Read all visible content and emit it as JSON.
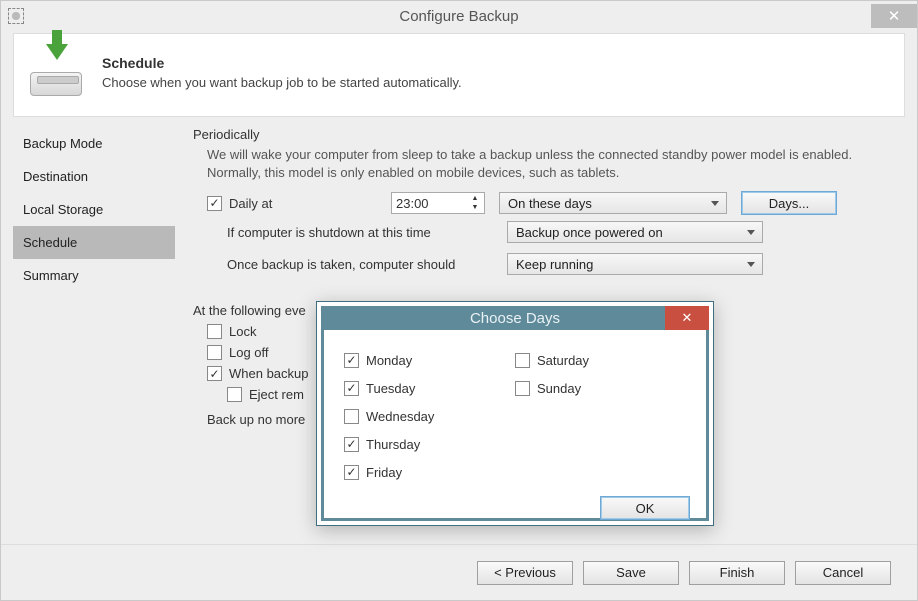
{
  "window": {
    "title": "Configure Backup",
    "close_glyph": "✕"
  },
  "header": {
    "title": "Schedule",
    "subtitle": "Choose when you want backup job to be started automatically."
  },
  "sidebar": {
    "items": [
      {
        "label": "Backup Mode",
        "active": false
      },
      {
        "label": "Destination",
        "active": false
      },
      {
        "label": "Local Storage",
        "active": false
      },
      {
        "label": "Schedule",
        "active": true
      },
      {
        "label": "Summary",
        "active": false
      }
    ]
  },
  "periodically": {
    "title": "Periodically",
    "note": "We will wake your computer from sleep to take a backup unless the connected standby power model is enabled. Normally, this model is only enabled on mobile devices, such as tablets.",
    "daily_checked": true,
    "daily_label": "Daily at",
    "daily_time": "23:00",
    "recurrence_value": "On these days",
    "days_button": "Days...",
    "shutdown_label": "If computer is shutdown at this time",
    "shutdown_value": "Backup once powered on",
    "after_label": "Once backup is taken, computer should",
    "after_value": "Keep running"
  },
  "events": {
    "title_fragment": "At the following eve",
    "lock_label": "Lock",
    "lock_checked": false,
    "logoff_label": "Log off",
    "logoff_checked": false,
    "whenbackup_label_fragment": "When backup",
    "whenbackup_checked": true,
    "ejectrem_label_fragment": "Eject rem",
    "ejectrem_checked": false,
    "nomore_label_fragment": "Back up no more"
  },
  "footer": {
    "previous": "< Previous",
    "save": "Save",
    "finish": "Finish",
    "cancel": "Cancel"
  },
  "modal": {
    "title": "Choose Days",
    "close_glyph": "✕",
    "days": {
      "monday": {
        "label": "Monday",
        "checked": true
      },
      "tuesday": {
        "label": "Tuesday",
        "checked": true
      },
      "wednesday": {
        "label": "Wednesday",
        "checked": false
      },
      "thursday": {
        "label": "Thursday",
        "checked": true
      },
      "friday": {
        "label": "Friday",
        "checked": true
      },
      "saturday": {
        "label": "Saturday",
        "checked": false
      },
      "sunday": {
        "label": "Sunday",
        "checked": false
      }
    },
    "ok": "OK"
  }
}
